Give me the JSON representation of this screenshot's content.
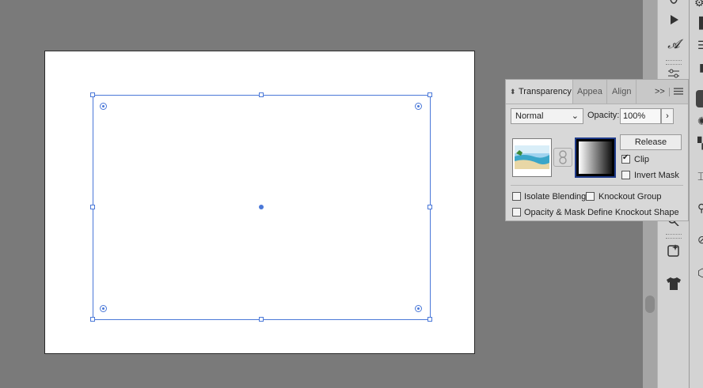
{
  "canvas": {
    "selection_color": "#4a78d8"
  },
  "panel": {
    "tabs": [
      {
        "label": "Transparency",
        "active": true
      },
      {
        "label": "Appea",
        "active": false
      },
      {
        "label": "Align",
        "active": false
      }
    ],
    "overflow_label": ">>",
    "menu_icon": "hamburger-menu-icon",
    "blend_mode": "Normal",
    "opacity_label": "Opacity:",
    "opacity_value": "100%",
    "release_label": "Release",
    "clip_label": "Clip",
    "clip_checked": true,
    "invert_mask_label": "Invert Mask",
    "invert_mask_checked": false,
    "isolate_blending_label": "Isolate Blending",
    "knockout_group_label": "Knockout Group",
    "opacity_mask_label": "Opacity & Mask Define Knockout Shape"
  },
  "toolbar": {
    "icons": [
      "touch-type-icon",
      "play-icon",
      "type-style-icon",
      "adjust-icon",
      "shaper-icon",
      "artboard-tool-icon",
      "zoom-tool-icon",
      "generative-icon",
      "tshirt-mockup-icon"
    ]
  }
}
